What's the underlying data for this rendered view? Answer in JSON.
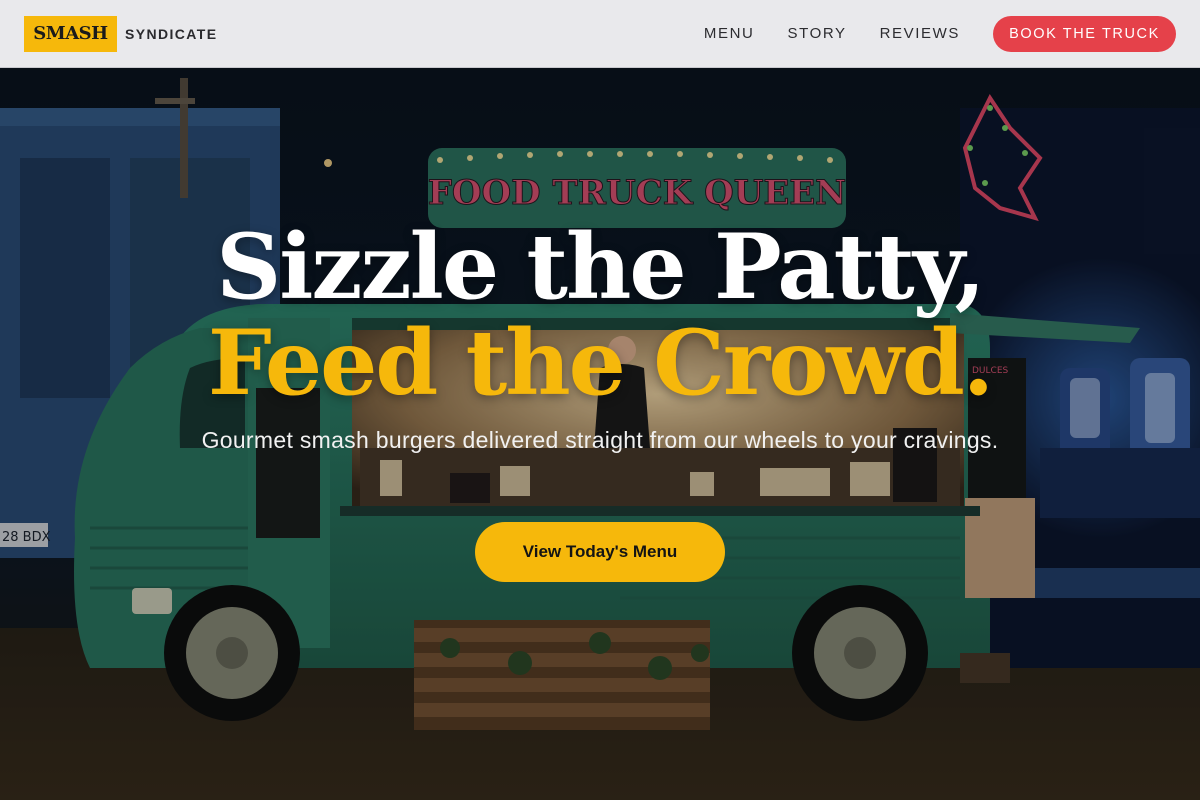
{
  "nav": {
    "logo_text": "SMASH",
    "brand_name": "SYNDICATE",
    "links": [
      "MENU",
      "STORY",
      "REVIEWS"
    ],
    "cta_label": "BOOK THE TRUCK"
  },
  "hero": {
    "headline_line1": "Sizzle the Patty,",
    "headline_line2": "Feed the Crowd.",
    "subtitle": "Gourmet smash burgers delivered straight from our wheels to your cravings.",
    "cta_label": "View Today's Menu",
    "truck_sign": "FOOD TRUCK QUEEN",
    "plate_text": "28 BDX",
    "side_board_text": "DULCES"
  },
  "colors": {
    "accent_yellow": "#f6b80b",
    "accent_red": "#e5414a",
    "nav_bg": "#e9e9ec",
    "truck_green": "#2f8a72"
  }
}
